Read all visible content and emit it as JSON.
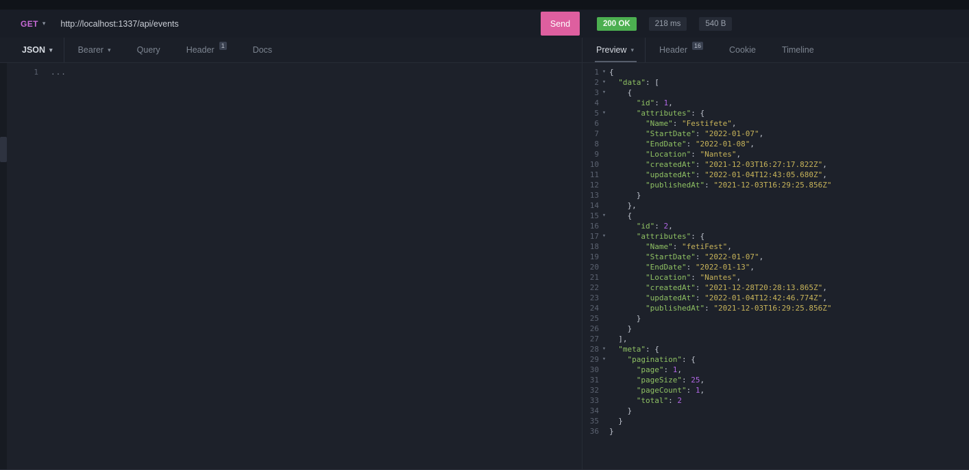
{
  "theme": {
    "method-color": "#c96bd8",
    "send-bg": "#de5f9f",
    "status-ok-bg": "#4caf50",
    "key-color": "#8fc163",
    "string-color": "#c8b45a",
    "number-color": "#b267e6",
    "punct-color": "#c3c8d2"
  },
  "request_bar": {
    "method": "GET",
    "url": "http://localhost:1337/api/events",
    "send_label": "Send"
  },
  "response_summary": {
    "status": "200 OK",
    "time": "218 ms",
    "size": "540 B"
  },
  "request_tabs": {
    "body_type": {
      "label": "JSON"
    },
    "auth": {
      "label": "Bearer"
    },
    "query": {
      "label": "Query"
    },
    "header": {
      "label": "Header",
      "badge": "1"
    },
    "docs": {
      "label": "Docs"
    }
  },
  "response_tabs": {
    "preview": {
      "label": "Preview"
    },
    "header": {
      "label": "Header",
      "badge": "16"
    },
    "cookie": {
      "label": "Cookie"
    },
    "timeline": {
      "label": "Timeline"
    }
  },
  "request_editor": {
    "line_number": "1",
    "placeholder_text": "..."
  },
  "response_body": {
    "language": "json",
    "lines": [
      {
        "n": 1,
        "fold": true,
        "indent": 0,
        "tokens": [
          [
            "p",
            "{"
          ]
        ]
      },
      {
        "n": 2,
        "fold": true,
        "indent": 1,
        "tokens": [
          [
            "k",
            "\"data\""
          ],
          [
            "p",
            ": ["
          ]
        ]
      },
      {
        "n": 3,
        "fold": true,
        "indent": 2,
        "tokens": [
          [
            "p",
            "{"
          ]
        ]
      },
      {
        "n": 4,
        "fold": false,
        "indent": 3,
        "tokens": [
          [
            "k",
            "\"id\""
          ],
          [
            "p",
            ": "
          ],
          [
            "n",
            "1"
          ],
          [
            "p",
            ","
          ]
        ]
      },
      {
        "n": 5,
        "fold": true,
        "indent": 3,
        "tokens": [
          [
            "k",
            "\"attributes\""
          ],
          [
            "p",
            ": {"
          ]
        ]
      },
      {
        "n": 6,
        "fold": false,
        "indent": 4,
        "tokens": [
          [
            "k",
            "\"Name\""
          ],
          [
            "p",
            ": "
          ],
          [
            "s",
            "\"Festifete\""
          ],
          [
            "p",
            ","
          ]
        ]
      },
      {
        "n": 7,
        "fold": false,
        "indent": 4,
        "tokens": [
          [
            "k",
            "\"StartDate\""
          ],
          [
            "p",
            ": "
          ],
          [
            "s",
            "\"2022-01-07\""
          ],
          [
            "p",
            ","
          ]
        ]
      },
      {
        "n": 8,
        "fold": false,
        "indent": 4,
        "tokens": [
          [
            "k",
            "\"EndDate\""
          ],
          [
            "p",
            ": "
          ],
          [
            "s",
            "\"2022-01-08\""
          ],
          [
            "p",
            ","
          ]
        ]
      },
      {
        "n": 9,
        "fold": false,
        "indent": 4,
        "tokens": [
          [
            "k",
            "\"Location\""
          ],
          [
            "p",
            ": "
          ],
          [
            "s",
            "\"Nantes\""
          ],
          [
            "p",
            ","
          ]
        ]
      },
      {
        "n": 10,
        "fold": false,
        "indent": 4,
        "tokens": [
          [
            "k",
            "\"createdAt\""
          ],
          [
            "p",
            ": "
          ],
          [
            "s",
            "\"2021-12-03T16:27:17.822Z\""
          ],
          [
            "p",
            ","
          ]
        ]
      },
      {
        "n": 11,
        "fold": false,
        "indent": 4,
        "tokens": [
          [
            "k",
            "\"updatedAt\""
          ],
          [
            "p",
            ": "
          ],
          [
            "s",
            "\"2022-01-04T12:43:05.680Z\""
          ],
          [
            "p",
            ","
          ]
        ]
      },
      {
        "n": 12,
        "fold": false,
        "indent": 4,
        "tokens": [
          [
            "k",
            "\"publishedAt\""
          ],
          [
            "p",
            ": "
          ],
          [
            "s",
            "\"2021-12-03T16:29:25.856Z\""
          ]
        ]
      },
      {
        "n": 13,
        "fold": false,
        "indent": 3,
        "tokens": [
          [
            "p",
            "}"
          ]
        ]
      },
      {
        "n": 14,
        "fold": false,
        "indent": 2,
        "tokens": [
          [
            "p",
            "},"
          ]
        ]
      },
      {
        "n": 15,
        "fold": true,
        "indent": 2,
        "tokens": [
          [
            "p",
            "{"
          ]
        ]
      },
      {
        "n": 16,
        "fold": false,
        "indent": 3,
        "tokens": [
          [
            "k",
            "\"id\""
          ],
          [
            "p",
            ": "
          ],
          [
            "n",
            "2"
          ],
          [
            "p",
            ","
          ]
        ]
      },
      {
        "n": 17,
        "fold": true,
        "indent": 3,
        "tokens": [
          [
            "k",
            "\"attributes\""
          ],
          [
            "p",
            ": {"
          ]
        ]
      },
      {
        "n": 18,
        "fold": false,
        "indent": 4,
        "tokens": [
          [
            "k",
            "\"Name\""
          ],
          [
            "p",
            ": "
          ],
          [
            "s",
            "\"fetiFest\""
          ],
          [
            "p",
            ","
          ]
        ]
      },
      {
        "n": 19,
        "fold": false,
        "indent": 4,
        "tokens": [
          [
            "k",
            "\"StartDate\""
          ],
          [
            "p",
            ": "
          ],
          [
            "s",
            "\"2022-01-07\""
          ],
          [
            "p",
            ","
          ]
        ]
      },
      {
        "n": 20,
        "fold": false,
        "indent": 4,
        "tokens": [
          [
            "k",
            "\"EndDate\""
          ],
          [
            "p",
            ": "
          ],
          [
            "s",
            "\"2022-01-13\""
          ],
          [
            "p",
            ","
          ]
        ]
      },
      {
        "n": 21,
        "fold": false,
        "indent": 4,
        "tokens": [
          [
            "k",
            "\"Location\""
          ],
          [
            "p",
            ": "
          ],
          [
            "s",
            "\"Nantes\""
          ],
          [
            "p",
            ","
          ]
        ]
      },
      {
        "n": 22,
        "fold": false,
        "indent": 4,
        "tokens": [
          [
            "k",
            "\"createdAt\""
          ],
          [
            "p",
            ": "
          ],
          [
            "s",
            "\"2021-12-28T20:28:13.865Z\""
          ],
          [
            "p",
            ","
          ]
        ]
      },
      {
        "n": 23,
        "fold": false,
        "indent": 4,
        "tokens": [
          [
            "k",
            "\"updatedAt\""
          ],
          [
            "p",
            ": "
          ],
          [
            "s",
            "\"2022-01-04T12:42:46.774Z\""
          ],
          [
            "p",
            ","
          ]
        ]
      },
      {
        "n": 24,
        "fold": false,
        "indent": 4,
        "tokens": [
          [
            "k",
            "\"publishedAt\""
          ],
          [
            "p",
            ": "
          ],
          [
            "s",
            "\"2021-12-03T16:29:25.856Z\""
          ]
        ]
      },
      {
        "n": 25,
        "fold": false,
        "indent": 3,
        "tokens": [
          [
            "p",
            "}"
          ]
        ]
      },
      {
        "n": 26,
        "fold": false,
        "indent": 2,
        "tokens": [
          [
            "p",
            "}"
          ]
        ]
      },
      {
        "n": 27,
        "fold": false,
        "indent": 1,
        "tokens": [
          [
            "p",
            "],"
          ]
        ]
      },
      {
        "n": 28,
        "fold": true,
        "indent": 1,
        "tokens": [
          [
            "k",
            "\"meta\""
          ],
          [
            "p",
            ": {"
          ]
        ]
      },
      {
        "n": 29,
        "fold": true,
        "indent": 2,
        "tokens": [
          [
            "k",
            "\"pagination\""
          ],
          [
            "p",
            ": {"
          ]
        ]
      },
      {
        "n": 30,
        "fold": false,
        "indent": 3,
        "tokens": [
          [
            "k",
            "\"page\""
          ],
          [
            "p",
            ": "
          ],
          [
            "n",
            "1"
          ],
          [
            "p",
            ","
          ]
        ]
      },
      {
        "n": 31,
        "fold": false,
        "indent": 3,
        "tokens": [
          [
            "k",
            "\"pageSize\""
          ],
          [
            "p",
            ": "
          ],
          [
            "n",
            "25"
          ],
          [
            "p",
            ","
          ]
        ]
      },
      {
        "n": 32,
        "fold": false,
        "indent": 3,
        "tokens": [
          [
            "k",
            "\"pageCount\""
          ],
          [
            "p",
            ": "
          ],
          [
            "n",
            "1"
          ],
          [
            "p",
            ","
          ]
        ]
      },
      {
        "n": 33,
        "fold": false,
        "indent": 3,
        "tokens": [
          [
            "k",
            "\"total\""
          ],
          [
            "p",
            ": "
          ],
          [
            "n",
            "2"
          ]
        ]
      },
      {
        "n": 34,
        "fold": false,
        "indent": 2,
        "tokens": [
          [
            "p",
            "}"
          ]
        ]
      },
      {
        "n": 35,
        "fold": false,
        "indent": 1,
        "tokens": [
          [
            "p",
            "}"
          ]
        ]
      },
      {
        "n": 36,
        "fold": false,
        "indent": 0,
        "tokens": [
          [
            "p",
            "}"
          ]
        ]
      }
    ]
  }
}
